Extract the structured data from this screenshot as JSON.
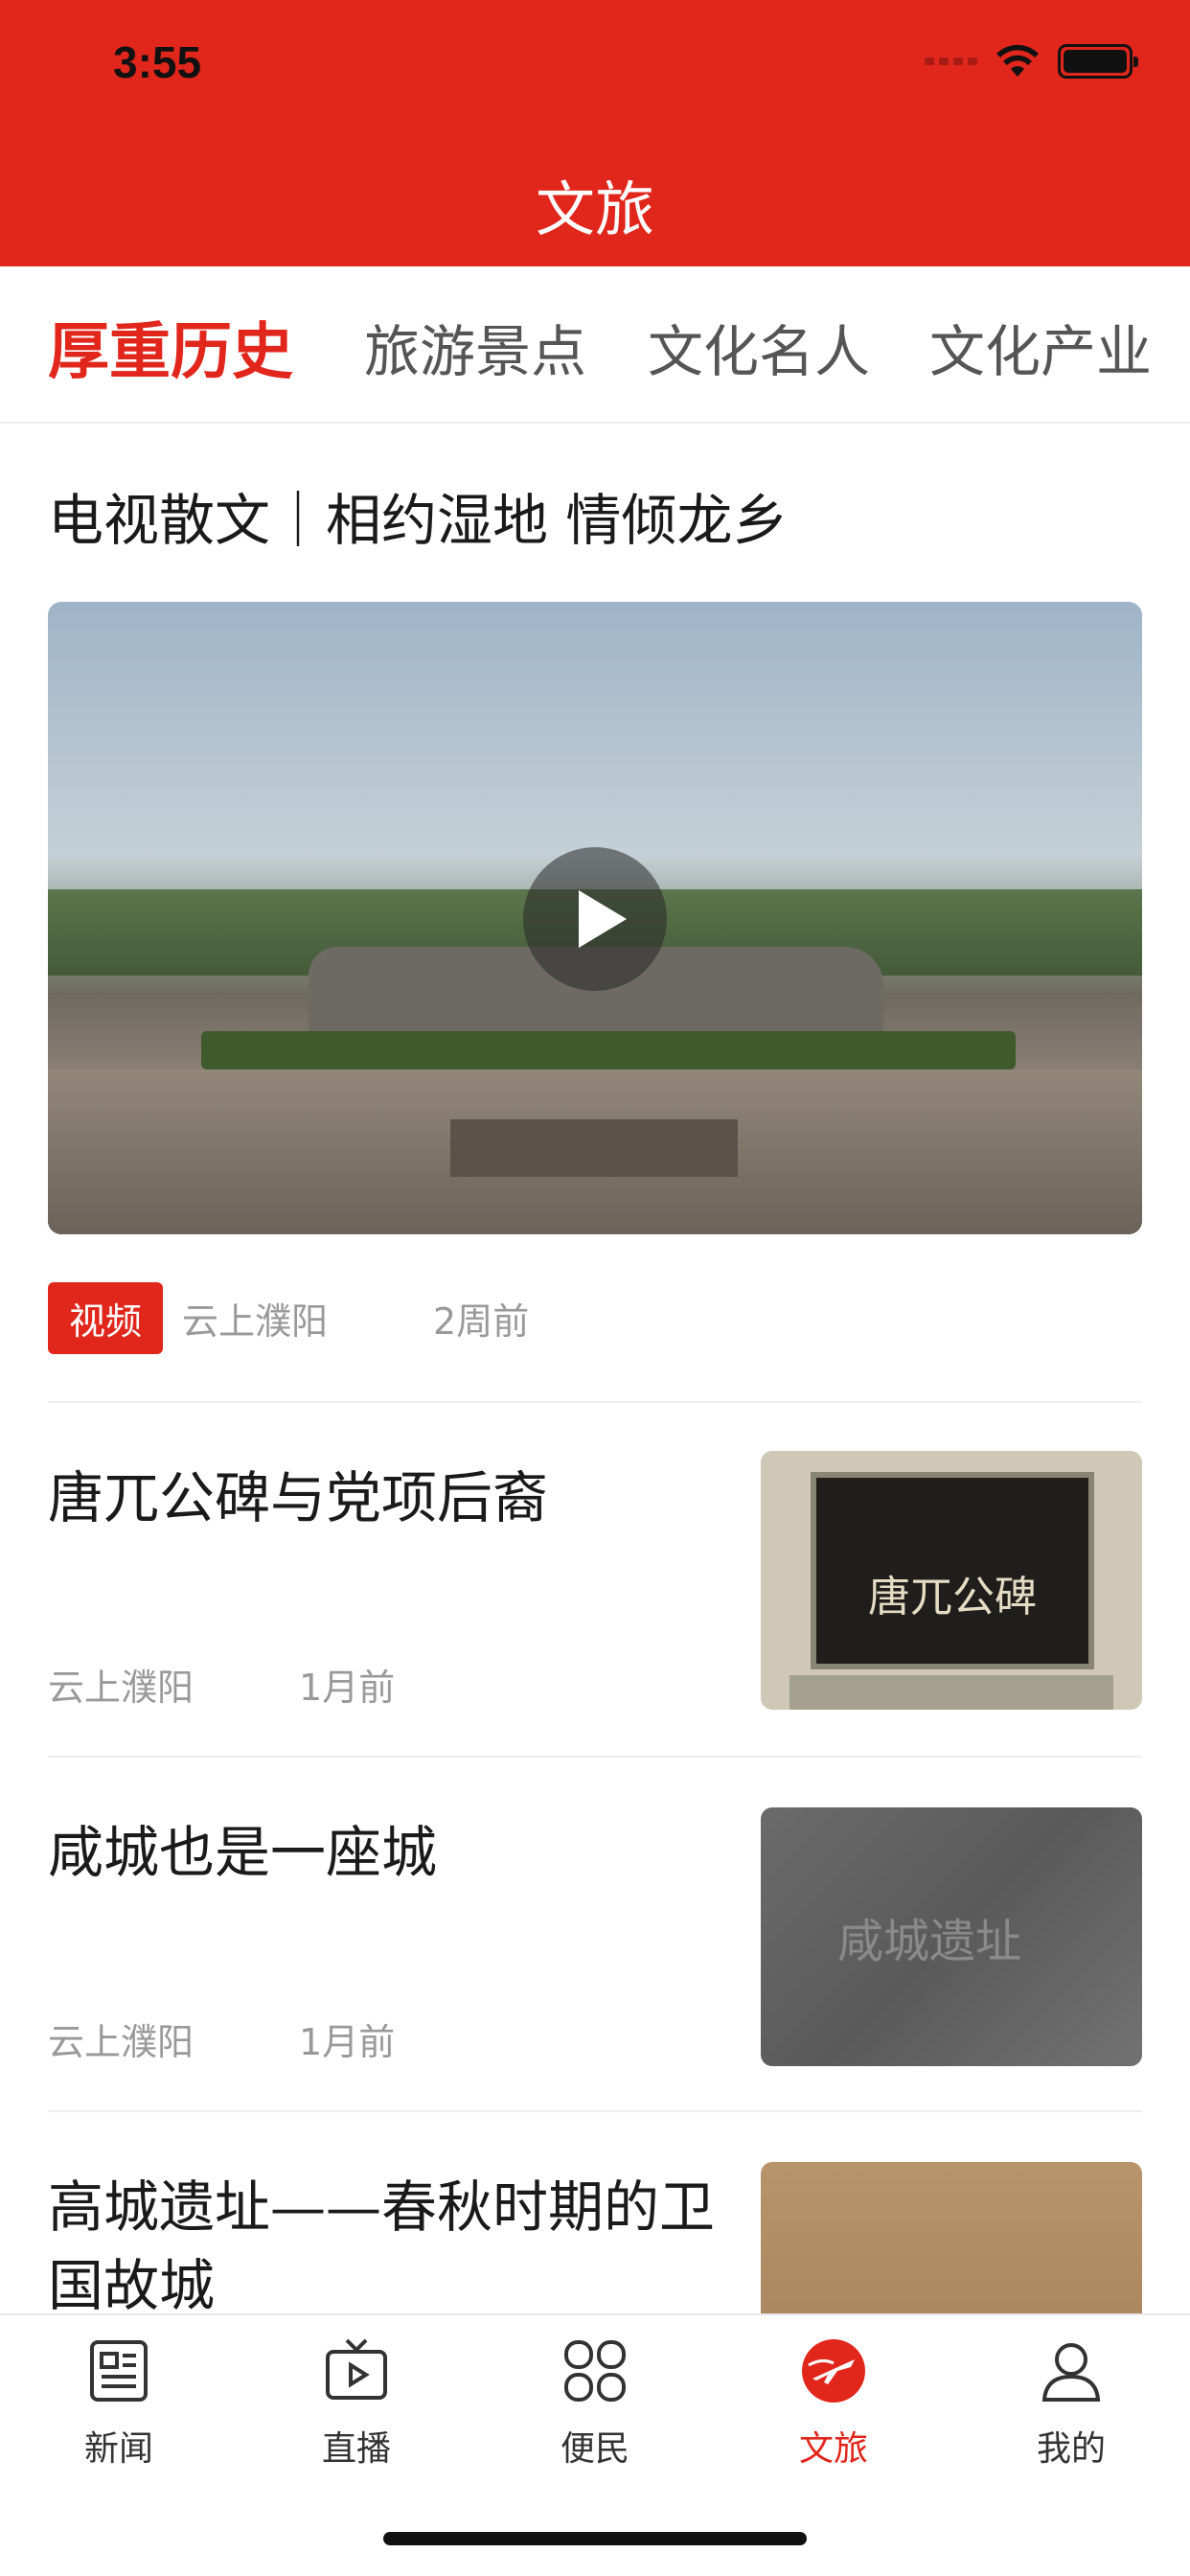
{
  "status_bar": {
    "time": "3:55"
  },
  "header": {
    "title": "文旅"
  },
  "tabs": [
    {
      "label": "厚重历史",
      "active": true
    },
    {
      "label": "旅游景点",
      "active": false
    },
    {
      "label": "文化名人",
      "active": false
    },
    {
      "label": "文化产业",
      "active": false
    }
  ],
  "feature": {
    "title": "电视散文｜相约湿地 情倾龙乡",
    "badge": "视频",
    "source": "云上濮阳",
    "time": "2周前"
  },
  "articles": [
    {
      "title": "唐兀公碑与党项后裔",
      "source": "云上濮阳",
      "time": "1月前",
      "thumb_text": "唐兀公碑"
    },
    {
      "title": "咸城也是一座城",
      "source": "云上濮阳",
      "time": "1月前",
      "thumb_text": "咸城遗址"
    },
    {
      "title": "高城遗址——春秋时期的卫国故城",
      "source": "",
      "time": ""
    }
  ],
  "tabbar": [
    {
      "label": "新闻",
      "icon": "news-icon",
      "active": false
    },
    {
      "label": "直播",
      "icon": "tv-icon",
      "active": false
    },
    {
      "label": "便民",
      "icon": "grid-icon",
      "active": false
    },
    {
      "label": "文旅",
      "icon": "travel-icon",
      "active": true
    },
    {
      "label": "我的",
      "icon": "user-icon",
      "active": false
    }
  ],
  "colors": {
    "brand_red": "#e1261c",
    "muted_text": "#999999"
  }
}
